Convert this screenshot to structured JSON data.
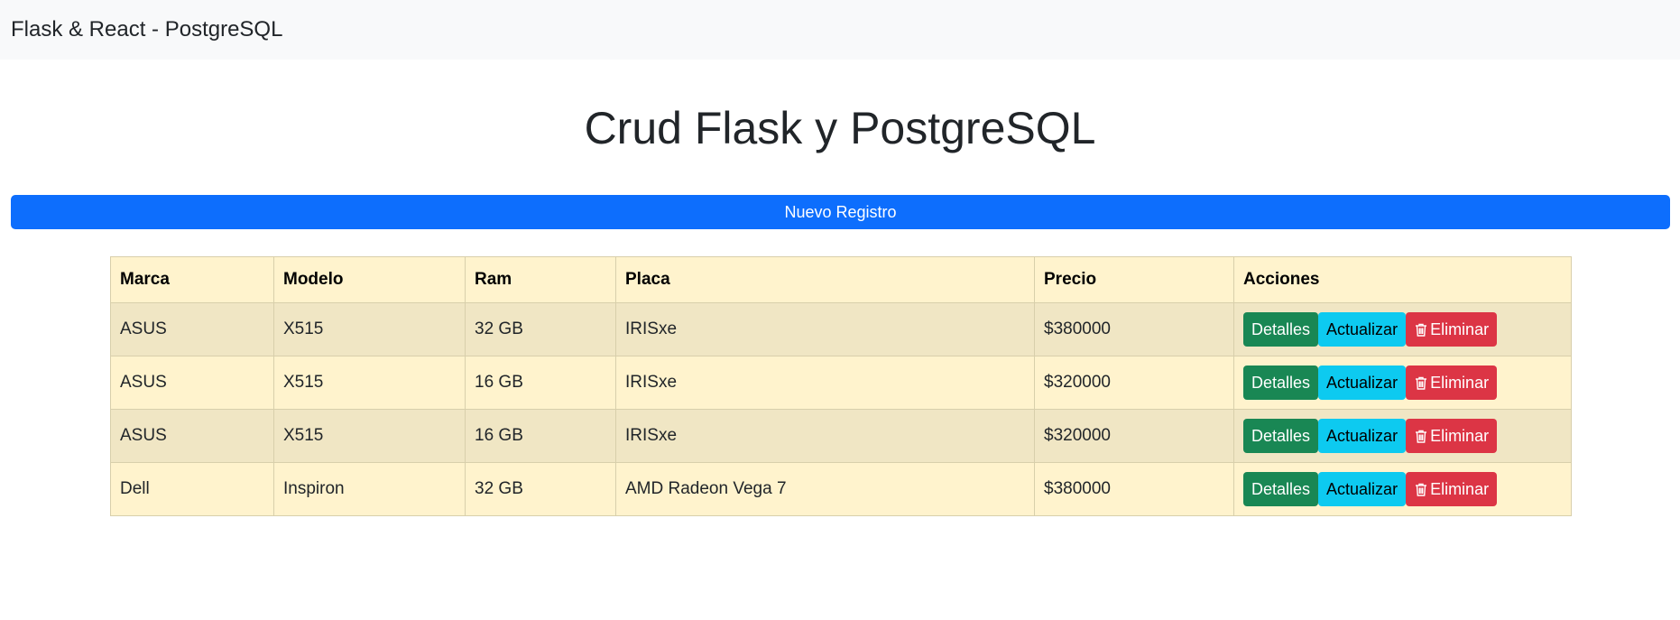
{
  "navbar": {
    "brand": "Flask & React - PostgreSQL"
  },
  "page": {
    "title": "Crud Flask y PostgreSQL"
  },
  "toolbar": {
    "new_record_label": "Nuevo Registro"
  },
  "table": {
    "headers": [
      "Marca",
      "Modelo",
      "Ram",
      "Placa",
      "Precio",
      "Acciones"
    ],
    "rows": [
      {
        "marca": "ASUS",
        "modelo": "X515",
        "ram": "32 GB",
        "placa": "IRISxe",
        "precio": "$380000"
      },
      {
        "marca": "ASUS",
        "modelo": "X515",
        "ram": "16 GB",
        "placa": "IRISxe",
        "precio": "$320000"
      },
      {
        "marca": "ASUS",
        "modelo": "X515",
        "ram": "16 GB",
        "placa": "IRISxe",
        "precio": "$320000"
      },
      {
        "marca": "Dell",
        "modelo": "Inspiron",
        "ram": "32 GB",
        "placa": "AMD Radeon Vega 7",
        "precio": "$380000"
      }
    ],
    "actions": {
      "details": "Detalles",
      "update": "Actualizar",
      "delete": "Eliminar"
    }
  },
  "colors": {
    "primary": "#0d6efd",
    "success": "#198754",
    "info": "#0dcaf0",
    "danger": "#dc3545",
    "table_warning": "#fff3cd",
    "navbar_bg": "#f8f9fa"
  },
  "icons": {
    "delete": "trash-icon"
  }
}
